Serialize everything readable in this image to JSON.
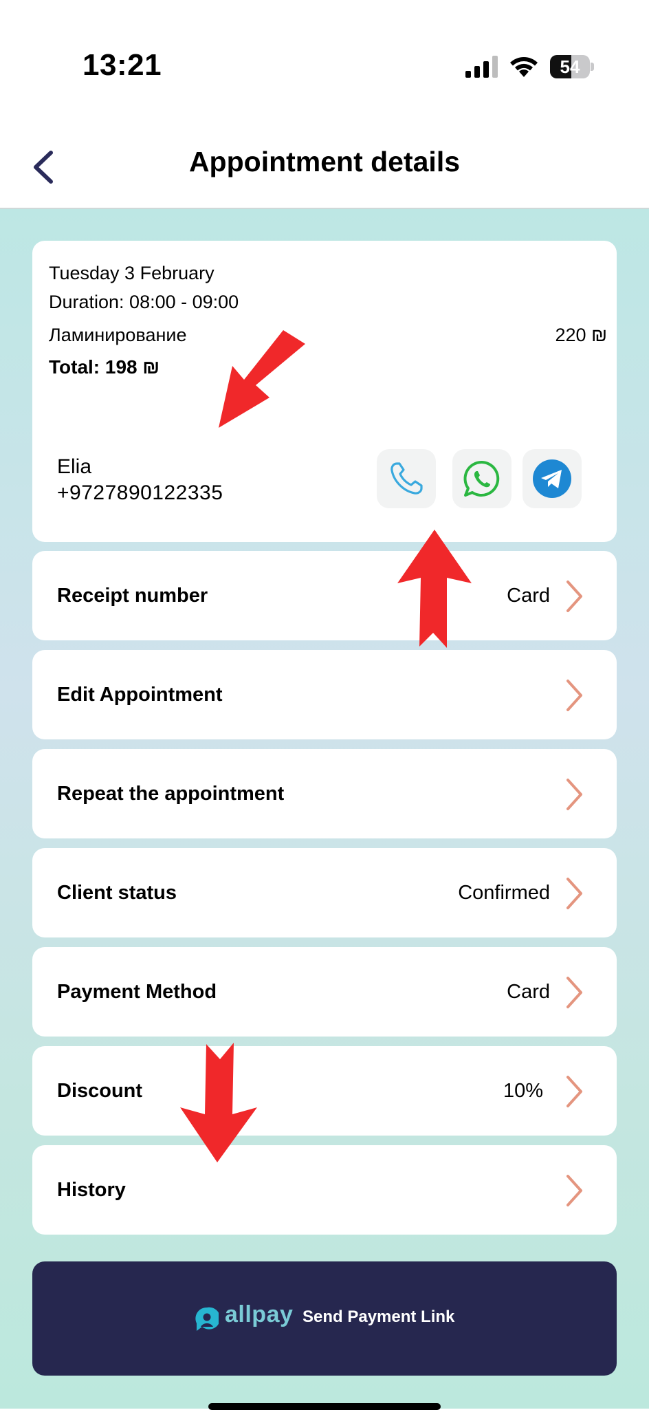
{
  "status_bar": {
    "time": "13:21",
    "battery_level": "54",
    "battery_percent": 54
  },
  "header": {
    "title": "Appointment details",
    "back_icon": "chevron-left-icon"
  },
  "summary": {
    "date": "Tuesday 3 February",
    "duration": "Duration: 08:00 - 09:00",
    "service": "Ламинирование",
    "price": "220 ₪",
    "total": "Total: 198 ₪"
  },
  "client": {
    "name": "Elia",
    "phone": "+9727890122335"
  },
  "contact_buttons": [
    {
      "icon": "phone-icon",
      "color": "#3aa9de"
    },
    {
      "icon": "whatsapp-icon",
      "color": "#2bb741"
    },
    {
      "icon": "telegram-icon",
      "color": "#1e88d3"
    }
  ],
  "rows": [
    {
      "label": "Receipt number",
      "value": "Card"
    },
    {
      "label": "Edit Appointment",
      "value": ""
    },
    {
      "label": "Repeat the appointment",
      "value": ""
    },
    {
      "label": "Client status",
      "value": "Confirmed"
    },
    {
      "label": "Payment Method",
      "value": "Card"
    },
    {
      "label": "Discount",
      "value": "10%"
    },
    {
      "label": "History",
      "value": ""
    }
  ],
  "payment_button": {
    "brand": "allpay",
    "label": "Send Payment Link"
  },
  "colors": {
    "accent_chevron": "#e4957f",
    "button_bg": "#26274f",
    "brand": "#7acbd6",
    "annotation_arrow": "#f0282a"
  }
}
